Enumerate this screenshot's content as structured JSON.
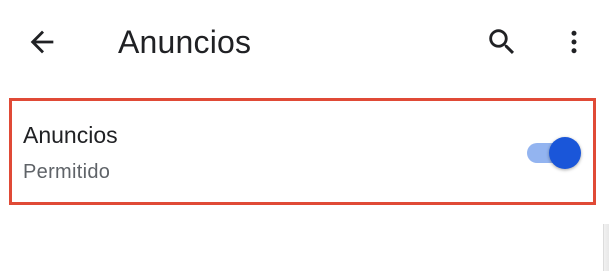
{
  "app_bar": {
    "title": "Anuncios",
    "back_icon": "arrow-back-icon",
    "search_icon": "search-icon",
    "more_icon": "more-vert-icon"
  },
  "setting": {
    "title": "Anuncios",
    "subtitle": "Permitido",
    "toggle_on": true,
    "highlight_color": "#e04a36",
    "toggle_color": "#1a56d9"
  }
}
